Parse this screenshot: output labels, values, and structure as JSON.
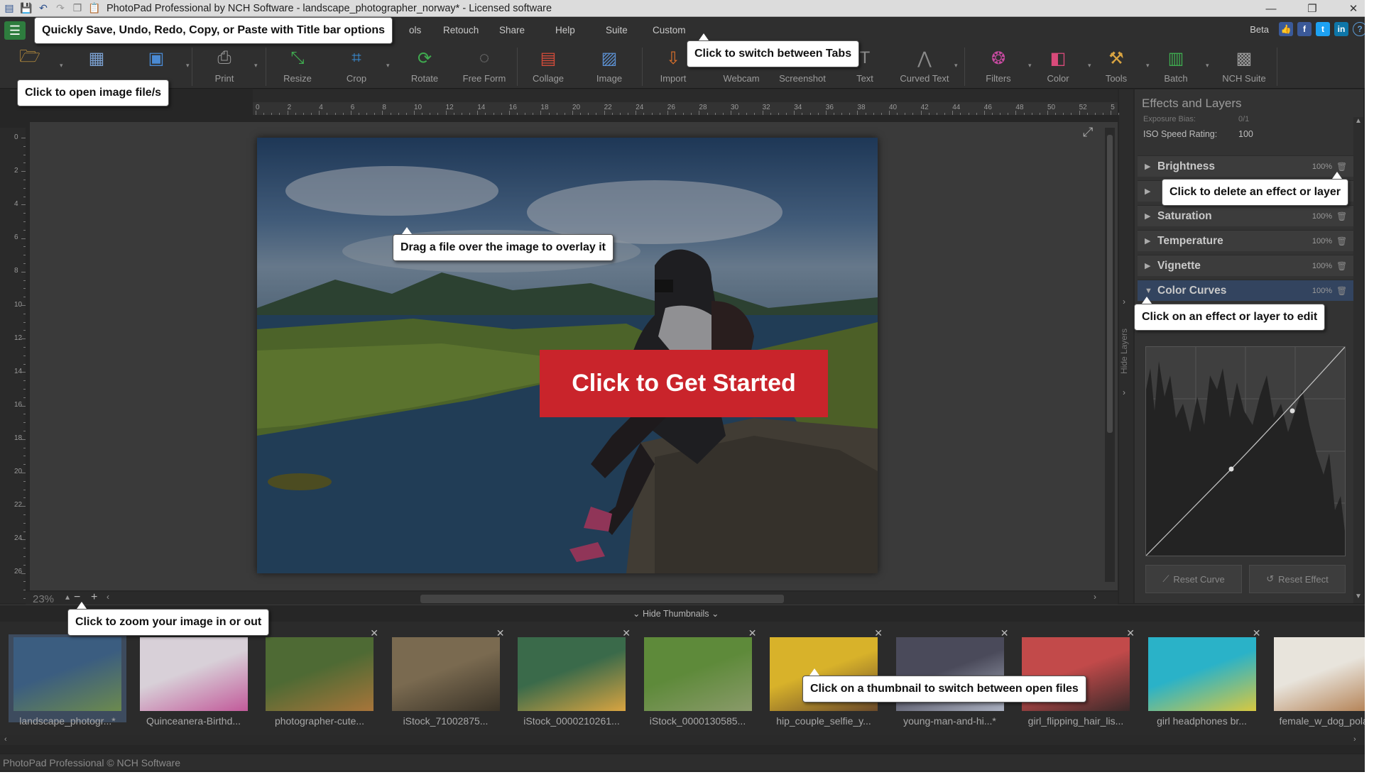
{
  "window": {
    "title": "PhotoPad Professional by NCH Software - landscape_photographer_norway* - Licensed software",
    "quick_icons": [
      "save-icon",
      "undo-icon",
      "redo-icon",
      "copy-icon",
      "paste-icon"
    ],
    "controls": [
      "minimize-icon",
      "restore-icon",
      "close-icon"
    ]
  },
  "menu": {
    "tabs": [
      "ols",
      "Retouch",
      "Share",
      "Help",
      "Suite",
      "Custom"
    ],
    "beta": "Beta",
    "social": [
      "like-icon",
      "facebook-icon",
      "twitter-icon",
      "linkedin-icon",
      "help-icon"
    ]
  },
  "toolbar": {
    "items": [
      {
        "label": "",
        "icon": "open-folder-icon",
        "color": "#d9a441"
      },
      {
        "label": "",
        "icon": "library-icon",
        "color": "#7a9fcf"
      },
      {
        "label": "",
        "icon": "save-disk-icon",
        "color": "#4a8ad4"
      },
      {
        "label": "Print",
        "icon": "printer-icon",
        "color": "#9a9a9a"
      },
      {
        "label": "Resize",
        "icon": "resize-icon",
        "color": "#3faa4f"
      },
      {
        "label": "Crop",
        "icon": "crop-icon",
        "color": "#3a8fd8"
      },
      {
        "label": "Rotate",
        "icon": "rotate-icon",
        "color": "#3faa4f"
      },
      {
        "label": "Free Form",
        "icon": "free-form-icon",
        "color": "#8a8a8a"
      },
      {
        "label": "Collage",
        "icon": "collage-icon",
        "color": "#d14b3a"
      },
      {
        "label": "Image",
        "icon": "image-icon",
        "color": "#5b8fd0"
      },
      {
        "label": "Import",
        "icon": "import-icon",
        "color": "#d9702b"
      },
      {
        "label": "Webcam",
        "icon": "webcam-icon",
        "color": "#8a8a8a"
      },
      {
        "label": "Screenshot",
        "icon": "screenshot-icon",
        "color": "#8a8a8a"
      },
      {
        "label": "Text",
        "icon": "text-icon",
        "color": "#8a8a8a"
      },
      {
        "label": "Curved Text",
        "icon": "curved-text-icon",
        "color": "#8a8a8a"
      },
      {
        "label": "Filters",
        "icon": "filters-icon",
        "color": "#c74aa0"
      },
      {
        "label": "Color",
        "icon": "color-icon",
        "color": "#d94a7a"
      },
      {
        "label": "Tools",
        "icon": "tools-icon",
        "color": "#d9a441"
      },
      {
        "label": "Batch",
        "icon": "batch-icon",
        "color": "#3faa4f"
      },
      {
        "label": "NCH Suite",
        "icon": "nch-suite-icon",
        "color": "#9a9a9a"
      }
    ]
  },
  "ruler": {
    "top": [
      "0",
      "2",
      "4",
      "6",
      "8",
      "10",
      "12",
      "14",
      "16",
      "18",
      "20",
      "22",
      "24",
      "26",
      "28",
      "30",
      "32",
      "34",
      "36",
      "38",
      "40",
      "42",
      "44",
      "46",
      "48",
      "50",
      "52",
      "5"
    ],
    "left": [
      "0",
      "2",
      "4",
      "6",
      "8",
      "10",
      "12",
      "14",
      "16",
      "18",
      "20",
      "22",
      "24",
      "26"
    ]
  },
  "canvas": {
    "cta": "Click to Get Started",
    "zoom": "23%"
  },
  "panel": {
    "title": "Effects and Layers",
    "partial": "Exposure Bias:",
    "partial_value": "0/1",
    "iso_label": "ISO Speed Rating:",
    "iso_value": "100",
    "effects": [
      {
        "name": "Brightness",
        "pct": "100%"
      },
      {
        "name": "",
        "pct": ""
      },
      {
        "name": "Saturation",
        "pct": "100%"
      },
      {
        "name": "Temperature",
        "pct": "100%"
      },
      {
        "name": "Vignette",
        "pct": "100%"
      },
      {
        "name": "Color Curves",
        "pct": "100%"
      }
    ],
    "hide_layers": "Hide Layers",
    "reset_curve": "Reset Curve",
    "reset_effect": "Reset Effect"
  },
  "thumbnails": {
    "hide_label": "Hide Thumbnails",
    "items": [
      {
        "label": "landscape_photogr...*",
        "colors": [
          "#3b5d80",
          "#6c8a4e"
        ]
      },
      {
        "label": "Quinceanera-Birthd...",
        "colors": [
          "#d8d0d8",
          "#c25a9a"
        ]
      },
      {
        "label": "photographer-cute...",
        "colors": [
          "#4e6a34",
          "#a8753a"
        ]
      },
      {
        "label": "iStock_71002875...",
        "colors": [
          "#7a6a50",
          "#3a3328"
        ]
      },
      {
        "label": "iStock_0000210261...",
        "colors": [
          "#3a6a4a",
          "#d9a441"
        ]
      },
      {
        "label": "iStock_0000130585...",
        "colors": [
          "#5e8a3a",
          "#8a9a6a"
        ]
      },
      {
        "label": "hip_couple_selfie_y...",
        "colors": [
          "#d8b22a",
          "#6a4a2a"
        ]
      },
      {
        "label": "young-man-and-hi...*",
        "colors": [
          "#4a4a5a",
          "#aab0c0"
        ]
      },
      {
        "label": "girl_flipping_hair_lis...",
        "colors": [
          "#c24a4a",
          "#3a2a2a"
        ]
      },
      {
        "label": "girl headphones br...",
        "colors": [
          "#2ab2c8",
          "#d8c840"
        ]
      },
      {
        "label": "female_w_dog_pola...",
        "colors": [
          "#e8e4dc",
          "#b07a4a"
        ]
      }
    ]
  },
  "status": {
    "text": "PhotoPad Professional © NCH Software"
  },
  "callouts": {
    "quick": "Quickly Save, Undo, Redo, Copy, or Paste with Title bar options",
    "open": "Click to open image file/s",
    "tabs": "Click to switch between Tabs",
    "drag": "Drag a file over the image to overlay it",
    "delete": "Click to delete an effect or layer",
    "edit": "Click on an effect or layer to edit",
    "zoom": "Click to zoom your image in or out",
    "thumbs": "Click on a thumbnail to switch between open files"
  }
}
